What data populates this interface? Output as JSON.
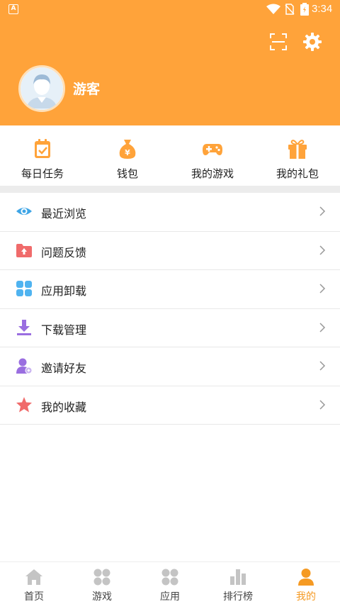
{
  "status_bar": {
    "time": "3:34"
  },
  "profile": {
    "username": "游客"
  },
  "colors": {
    "accent": "#FFA33A",
    "active_nav": "#F59A23"
  },
  "quick_actions": [
    {
      "label": "每日任务",
      "icon": "clipboard-check-icon"
    },
    {
      "label": "钱包",
      "icon": "money-bag-icon"
    },
    {
      "label": "我的游戏",
      "icon": "gamepad-icon"
    },
    {
      "label": "我的礼包",
      "icon": "gift-icon"
    }
  ],
  "menu": [
    {
      "label": "最近浏览",
      "icon": "eye-icon"
    },
    {
      "label": "问题反馈",
      "icon": "feedback-folder-icon"
    },
    {
      "label": "应用卸载",
      "icon": "apps-grid-icon"
    },
    {
      "label": "下载管理",
      "icon": "download-icon"
    },
    {
      "label": "邀请好友",
      "icon": "invite-user-icon"
    },
    {
      "label": "我的收藏",
      "icon": "star-icon"
    }
  ],
  "bottom_nav": [
    {
      "label": "首页",
      "icon": "home-icon",
      "active": false
    },
    {
      "label": "游戏",
      "icon": "games-grid-icon",
      "active": false
    },
    {
      "label": "应用",
      "icon": "apps-icon",
      "active": false
    },
    {
      "label": "排行榜",
      "icon": "ranking-icon",
      "active": false
    },
    {
      "label": "我的",
      "icon": "profile-icon",
      "active": true
    }
  ]
}
